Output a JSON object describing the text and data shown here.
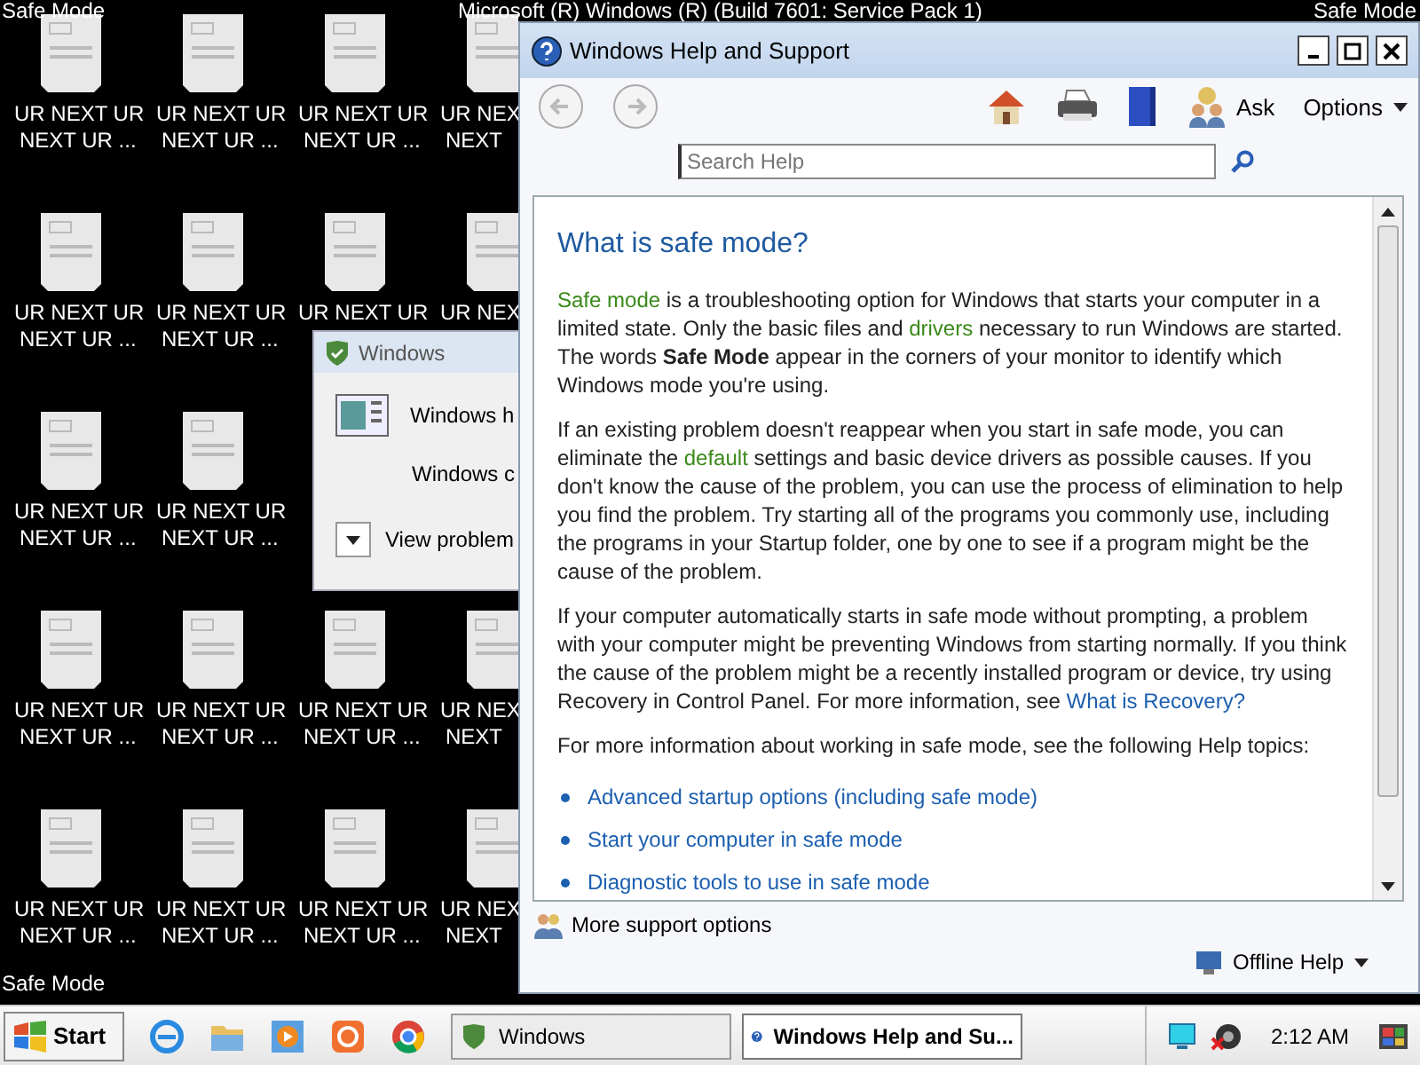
{
  "desktop": {
    "corner_labels": {
      "top_left": "Safe Mode",
      "top_center": "Microsoft (R) Windows (R) (Build 7601: Service Pack 1)",
      "top_right": "Safe Mode",
      "bottom_left": "Safe Mode"
    },
    "icon_columns": [
      [
        {
          "lines": [
            "UR NEXT UR",
            "NEXT UR ..."
          ]
        },
        {
          "lines": [
            "UR NEXT UR",
            "NEXT UR ..."
          ]
        },
        {
          "lines": [
            "UR NEXT UR",
            "NEXT UR ..."
          ]
        },
        {
          "lines": [
            "UR NEXT UR",
            "NEXT UR ..."
          ]
        },
        {
          "lines": [
            "UR NEXT UR",
            "NEXT UR ..."
          ]
        }
      ],
      [
        {
          "lines": [
            "UR NEXT UR",
            "NEXT UR ..."
          ]
        },
        {
          "lines": [
            "UR NEXT UR",
            "NEXT UR ..."
          ]
        },
        {
          "lines": [
            "UR NEXT UR",
            "NEXT UR ..."
          ]
        },
        {
          "lines": [
            "UR NEXT UR",
            "NEXT UR ..."
          ]
        },
        {
          "lines": [
            "UR NEXT UR",
            "NEXT UR ..."
          ]
        }
      ],
      [
        {
          "lines": [
            "UR NEXT UR",
            "NEXT UR ..."
          ]
        },
        {
          "lines": [
            "UR NEXT UR"
          ]
        },
        {},
        {
          "lines": [
            "UR NEXT UR",
            "NEXT UR ..."
          ]
        },
        {
          "lines": [
            "UR NEXT UR",
            "NEXT UR ..."
          ]
        }
      ],
      [
        {
          "lines": [
            "UR NEX",
            "NEXT"
          ]
        },
        {
          "lines": [
            "UR NEX"
          ]
        },
        {},
        {
          "lines": [
            "UR NEX",
            "NEXT"
          ]
        },
        {
          "lines": [
            "UR NEX",
            "NEXT"
          ]
        }
      ]
    ]
  },
  "dialog": {
    "title": "Windows",
    "line_1": "Windows h",
    "line_2": "Windows c",
    "details_button": "View problem"
  },
  "help_window": {
    "title": "Windows Help and Support",
    "toolbar": {
      "ask": "Ask",
      "options": "Options"
    },
    "search": {
      "placeholder": "Search Help"
    },
    "content": {
      "heading": "What is safe mode?",
      "paragraphs": [
        [
          {
            "kind": "term",
            "text": "Safe mode"
          },
          {
            "kind": "plain",
            "text": " is a troubleshooting option for Windows that starts your computer in a limited state. Only the basic files and "
          },
          {
            "kind": "term",
            "text": "drivers"
          },
          {
            "kind": "plain",
            "text": " necessary to run Windows are started. The words "
          },
          {
            "kind": "bold",
            "text": "Safe Mode"
          },
          {
            "kind": "plain",
            "text": " appear in the corners of your monitor to identify which Windows mode you're using."
          }
        ],
        [
          {
            "kind": "plain",
            "text": "If an existing problem doesn't reappear when you start in safe mode, you can eliminate the "
          },
          {
            "kind": "term",
            "text": "default"
          },
          {
            "kind": "plain",
            "text": " settings and basic device drivers as possible causes. If you don't know the cause of the problem, you can use the process of elimination to help you find the problem. Try starting all of the programs you commonly use, including the programs in your Startup folder, one by one to see if a program might be the cause of the problem."
          }
        ],
        [
          {
            "kind": "plain",
            "text": "If your computer automatically starts in safe mode without prompting, a problem with your computer might be preventing Windows from starting normally. If you think the cause of the problem might be a recently installed program or device, try using Recovery in Control Panel. For more information, see "
          },
          {
            "kind": "link",
            "text": "What is Recovery?"
          }
        ],
        [
          {
            "kind": "plain",
            "text": "For more information about working in safe mode, see the following Help topics:"
          }
        ]
      ],
      "topics": [
        "Advanced startup options (including safe mode)",
        "Start your computer in safe mode",
        "Diagnostic tools to use in safe mode"
      ]
    },
    "more_support": "More support options",
    "offline_help": "Offline Help"
  },
  "taskbar": {
    "start": "Start",
    "tasks": [
      {
        "label": "Windows",
        "selected": false
      },
      {
        "label": "Windows Help and Su...",
        "selected": true
      }
    ],
    "clock": "2:12 AM"
  }
}
